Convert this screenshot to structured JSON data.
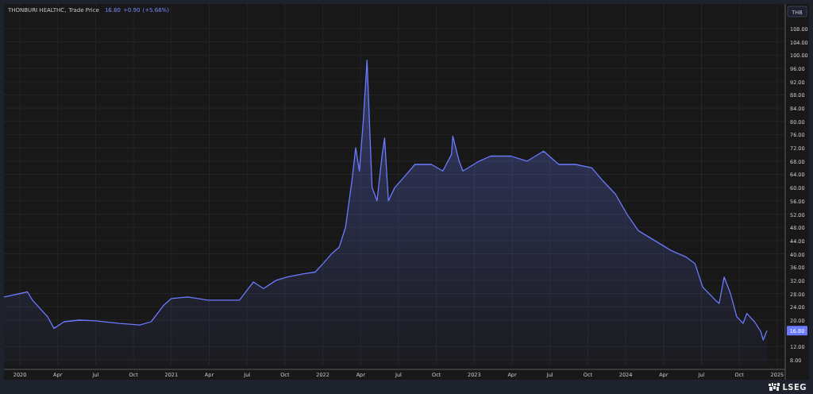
{
  "header": {
    "instrument": "THONBURI HEALTHC,",
    "price": "16.80",
    "change": "+0.90",
    "change_pct": "(+5.66%)"
  },
  "currency": "THB",
  "last_price_tag": "16.80",
  "chart_data": {
    "type": "area",
    "grid": true,
    "xlim": [
      2019.895,
      2025.053
    ],
    "ylim": [
      6.32,
      115.43
    ],
    "xticks": [
      {
        "value": 2020,
        "label": "2020"
      },
      {
        "value": 2020.25,
        "label": "Apr"
      },
      {
        "value": 2020.5,
        "label": "Jul"
      },
      {
        "value": 2020.75,
        "label": "Oct"
      },
      {
        "value": 2021,
        "label": "2021"
      },
      {
        "value": 2021.25,
        "label": "Apr"
      },
      {
        "value": 2021.5,
        "label": "Jul"
      },
      {
        "value": 2021.75,
        "label": "Oct"
      },
      {
        "value": 2022,
        "label": "2022"
      },
      {
        "value": 2022.25,
        "label": "Apr"
      },
      {
        "value": 2022.5,
        "label": "Jul"
      },
      {
        "value": 2022.75,
        "label": "Oct"
      },
      {
        "value": 2023,
        "label": "2023"
      },
      {
        "value": 2023.25,
        "label": "Apr"
      },
      {
        "value": 2023.5,
        "label": "Jul"
      },
      {
        "value": 2023.75,
        "label": "Oct"
      },
      {
        "value": 2024,
        "label": "2024"
      },
      {
        "value": 2024.25,
        "label": "Apr"
      },
      {
        "value": 2024.5,
        "label": "Jul"
      },
      {
        "value": 2024.75,
        "label": "Oct"
      },
      {
        "value": 2025,
        "label": "2025"
      }
    ],
    "yticks": [
      {
        "value": 8,
        "label": "8.00"
      },
      {
        "value": 12,
        "label": "12.00"
      },
      {
        "value": 20,
        "label": "20.00"
      },
      {
        "value": 24,
        "label": "24.00"
      },
      {
        "value": 28,
        "label": "28.00"
      },
      {
        "value": 32,
        "label": "32.00"
      },
      {
        "value": 36,
        "label": "36.00"
      },
      {
        "value": 40,
        "label": "40.00"
      },
      {
        "value": 44,
        "label": "44.00"
      },
      {
        "value": 48,
        "label": "48.00"
      },
      {
        "value": 52,
        "label": "52.00"
      },
      {
        "value": 56,
        "label": "56.00"
      },
      {
        "value": 60,
        "label": "60.00"
      },
      {
        "value": 64,
        "label": "64.00"
      },
      {
        "value": 68,
        "label": "68.00"
      },
      {
        "value": 72,
        "label": "72.00"
      },
      {
        "value": 76,
        "label": "76.00"
      },
      {
        "value": 80,
        "label": "80.00"
      },
      {
        "value": 84,
        "label": "84.00"
      },
      {
        "value": 88,
        "label": "88.00"
      },
      {
        "value": 92,
        "label": "92.00"
      },
      {
        "value": 96,
        "label": "96.00"
      },
      {
        "value": 100,
        "label": "100.00"
      },
      {
        "value": 104,
        "label": "104.00"
      },
      {
        "value": 108,
        "label": "108.00"
      }
    ],
    "x": [
      2019.895,
      2020.05,
      2020.083,
      2020.183,
      2020.225,
      2020.292,
      2020.392,
      2020.5,
      2020.658,
      2020.792,
      2020.867,
      2020.95,
      2021,
      2021.108,
      2021.242,
      2021.342,
      2021.45,
      2021.5,
      2021.542,
      2021.608,
      2021.692,
      2021.767,
      2021.875,
      2021.95,
      2022,
      2022.058,
      2022.108,
      2022.15,
      2022.192,
      2022.217,
      2022.242,
      2022.267,
      2022.292,
      2022.308,
      2022.325,
      2022.358,
      2022.392,
      2022.408,
      2022.433,
      2022.475,
      2022.533,
      2022.608,
      2022.717,
      2022.792,
      2022.85,
      2022.858,
      2022.9,
      2022.925,
      2023.033,
      2023.108,
      2023.242,
      2023.35,
      2023.458,
      2023.558,
      2023.667,
      2023.775,
      2023.85,
      2023.933,
      2024.008,
      2024.083,
      2024.192,
      2024.3,
      2024.4,
      2024.458,
      2024.508,
      2024.592,
      2024.617,
      2024.65,
      2024.692,
      2024.733,
      2024.775,
      2024.8,
      2024.85,
      2024.892,
      2024.908,
      2024.925,
      2024.933
    ],
    "series": [
      {
        "name": "Trade Price",
        "color": "#6a7bff",
        "values": [
          27,
          28.5,
          26,
          21,
          17.5,
          19.5,
          20,
          19.8,
          19,
          18.5,
          19.5,
          24.5,
          26.5,
          27,
          26,
          26,
          26,
          29,
          31.5,
          29.5,
          32,
          33,
          34,
          34.5,
          37,
          40,
          42,
          48,
          62,
          72,
          65,
          80,
          98.5,
          80,
          60,
          56,
          70,
          75,
          56,
          60,
          63,
          67,
          67,
          65,
          70,
          75.5,
          68,
          65,
          68,
          69.5,
          69.5,
          68,
          71,
          67,
          67,
          66,
          62,
          58,
          52,
          47,
          44,
          41,
          39,
          37,
          30,
          26,
          25,
          33,
          28,
          21,
          19,
          22,
          19.5,
          16.5,
          14,
          16,
          16.8
        ]
      }
    ]
  },
  "logo": "LSEG"
}
